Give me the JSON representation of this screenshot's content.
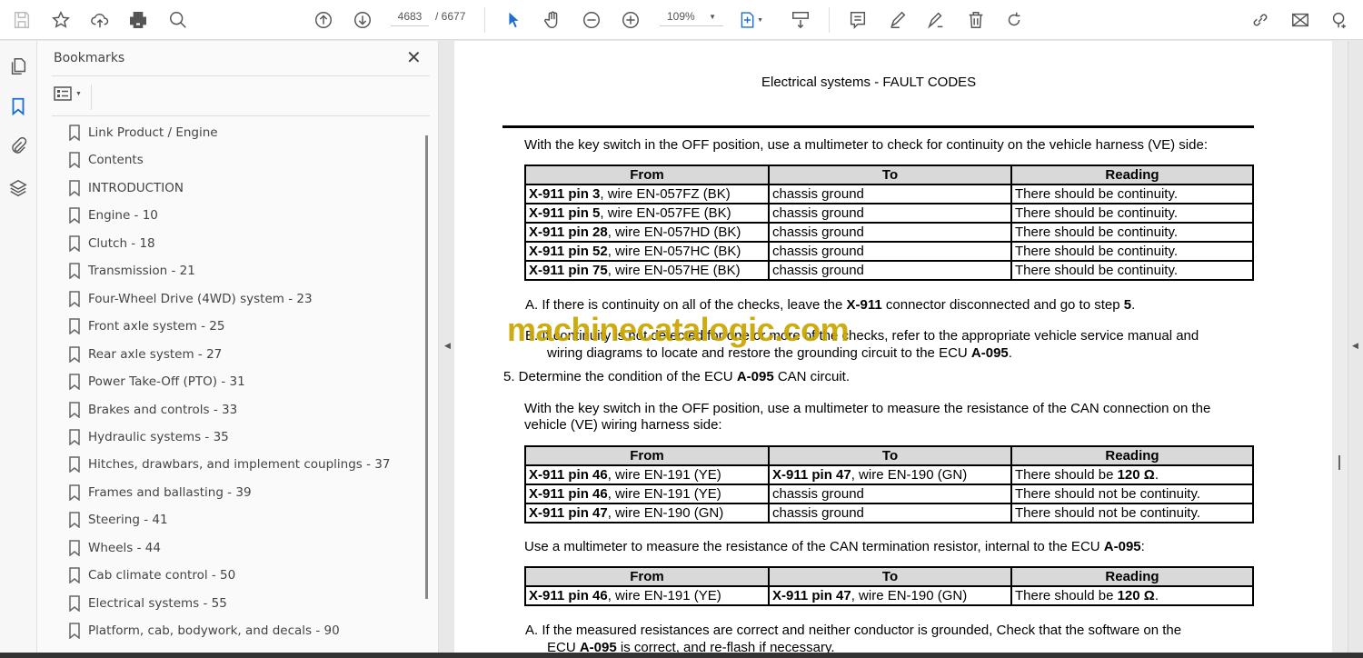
{
  "toolbar": {
    "page_current": "4683",
    "page_total": "/ 6677",
    "zoom": "109%"
  },
  "bookmarks": {
    "title": "Bookmarks",
    "items": [
      "Link Product / Engine",
      "Contents",
      "INTRODUCTION",
      "Engine - 10",
      "Clutch - 18",
      "Transmission - 21",
      "Four-Wheel Drive (4WD) system - 23",
      "Front axle system - 25",
      "Rear axle system - 27",
      "Power Take-Off (PTO) - 31",
      "Brakes and controls - 33",
      "Hydraulic systems - 35",
      "Hitches, drawbars, and implement couplings - 37",
      "Frames and ballasting - 39",
      "Steering - 41",
      "Wheels - 44",
      "Cab climate control - 50",
      "Electrical systems - 55",
      "Platform, cab, bodywork, and decals - 90"
    ]
  },
  "document": {
    "header": "Electrical systems - FAULT CODES",
    "watermark": "machinecatalogic.com",
    "p1": "With the key switch in the OFF position, use a multimeter to check for continuity on the vehicle harness (VE) side:",
    "columns": [
      "From",
      "To",
      "Reading"
    ],
    "table1": [
      [
        [
          [
            "X-911 pin 3",
            1
          ],
          [
            ", wire EN-057FZ (BK)",
            0
          ]
        ],
        [
          [
            "chassis ground",
            0
          ]
        ],
        [
          [
            "There should be continuity.",
            0
          ]
        ]
      ],
      [
        [
          [
            "X-911 pin 5",
            1
          ],
          [
            ", wire EN-057FE (BK)",
            0
          ]
        ],
        [
          [
            "chassis ground",
            0
          ]
        ],
        [
          [
            "There should be continuity.",
            0
          ]
        ]
      ],
      [
        [
          [
            "X-911 pin 28",
            1
          ],
          [
            ", wire EN-057HD (BK)",
            0
          ]
        ],
        [
          [
            "chassis ground",
            0
          ]
        ],
        [
          [
            "There should be continuity.",
            0
          ]
        ]
      ],
      [
        [
          [
            "X-911 pin 52",
            1
          ],
          [
            ", wire EN-057HC (BK)",
            0
          ]
        ],
        [
          [
            "chassis ground",
            0
          ]
        ],
        [
          [
            "There should be continuity.",
            0
          ]
        ]
      ],
      [
        [
          [
            "X-911 pin 75",
            1
          ],
          [
            ", wire EN-057HE (BK)",
            0
          ]
        ],
        [
          [
            "chassis ground",
            0
          ]
        ],
        [
          [
            "There should be continuity.",
            0
          ]
        ]
      ]
    ],
    "stepA1": [
      [
        "A.  If there is continuity on all of the checks, leave the ",
        0
      ],
      [
        "X-911",
        1
      ],
      [
        " connector disconnected and go to step ",
        0
      ],
      [
        "5",
        1
      ],
      [
        ".",
        0
      ]
    ],
    "stepB1a": [
      [
        "B.  If continuity is not detected for one or more of the checks, refer to the appropriate vehicle service manual and",
        0
      ]
    ],
    "stepB1b": [
      [
        "wiring diagrams to locate and restore the grounding circuit to the ECU ",
        0
      ],
      [
        "A-095",
        1
      ],
      [
        ".",
        0
      ]
    ],
    "step5": [
      [
        "5.  Determine the condition of the ECU ",
        0
      ],
      [
        "A-095",
        1
      ],
      [
        " CAN circuit.",
        0
      ]
    ],
    "p2a": "With the key switch in the OFF position, use a multimeter to measure the resistance of the CAN connection on the",
    "p2b": "vehicle (VE) wiring harness side:",
    "table2": [
      [
        [
          [
            "X-911 pin 46",
            1
          ],
          [
            ", wire EN-191 (YE)",
            0
          ]
        ],
        [
          [
            "X-911 pin 47",
            1
          ],
          [
            ", wire EN-190 (GN)",
            0
          ]
        ],
        [
          [
            "There should be ",
            0
          ],
          [
            "120 Ω",
            1
          ],
          [
            ".",
            0
          ]
        ]
      ],
      [
        [
          [
            "X-911 pin 46",
            1
          ],
          [
            ", wire EN-191 (YE)",
            0
          ]
        ],
        [
          [
            "chassis ground",
            0
          ]
        ],
        [
          [
            "There should not be continuity.",
            0
          ]
        ]
      ],
      [
        [
          [
            "X-911 pin 47",
            1
          ],
          [
            ", wire EN-190 (GN)",
            0
          ]
        ],
        [
          [
            "chassis ground",
            0
          ]
        ],
        [
          [
            "There should not be continuity.",
            0
          ]
        ]
      ]
    ],
    "p3": [
      [
        "Use a multimeter to measure the resistance of the CAN termination resistor, internal to the ECU ",
        0
      ],
      [
        "A-095",
        1
      ],
      [
        ":",
        0
      ]
    ],
    "table3": [
      [
        [
          [
            "X-911 pin 46",
            1
          ],
          [
            ", wire EN-191 (YE)",
            0
          ]
        ],
        [
          [
            "X-911 pin 47",
            1
          ],
          [
            ", wire EN-190 (GN)",
            0
          ]
        ],
        [
          [
            "There should be ",
            0
          ],
          [
            "120 Ω",
            1
          ],
          [
            ".",
            0
          ]
        ]
      ]
    ],
    "stepA2a": [
      [
        "A.  If the measured resistances are correct and neither conductor is grounded, Check that the software on the",
        0
      ]
    ],
    "stepA2b": [
      [
        "ECU ",
        0
      ],
      [
        "A-095",
        1
      ],
      [
        " is correct, and re-flash if necessary.",
        0
      ]
    ]
  }
}
